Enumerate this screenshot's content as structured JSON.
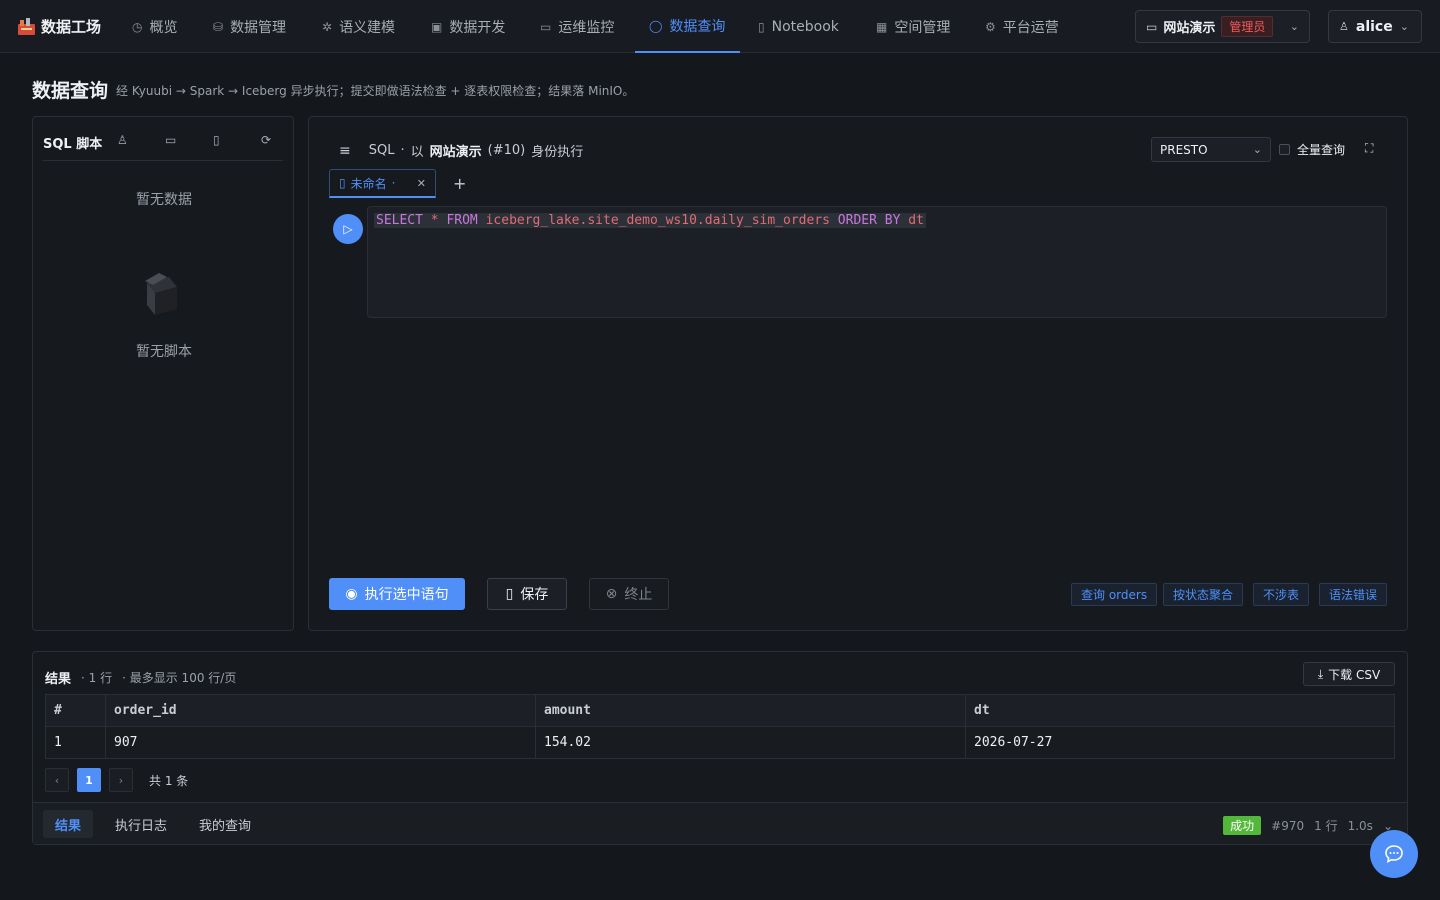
{
  "app": {
    "brand": "数据工场"
  },
  "nav": [
    {
      "icon": "dashboard-icon",
      "glyph": "◷",
      "label": "概览"
    },
    {
      "icon": "database-icon",
      "glyph": "⛁",
      "label": "数据管理"
    },
    {
      "icon": "sparkle-icon",
      "glyph": "✲",
      "label": "语义建模"
    },
    {
      "icon": "code-box-icon",
      "glyph": "▣",
      "label": "数据开发"
    },
    {
      "icon": "monitor-icon",
      "glyph": "▭",
      "label": "运维监控"
    },
    {
      "icon": "search-icon",
      "glyph": "◯",
      "label": "数据查询",
      "active": true
    },
    {
      "icon": "notebook-icon",
      "glyph": "▯",
      "label": "Notebook"
    },
    {
      "icon": "building-icon",
      "glyph": "▦",
      "label": "空间管理"
    },
    {
      "icon": "gear-icon",
      "glyph": "⚙",
      "label": "平台运营"
    }
  ],
  "workspace": {
    "name": "网站演示",
    "role": "管理员"
  },
  "user": {
    "name": "alice"
  },
  "page": {
    "title": "数据查询",
    "description": "经 Kyuubi → Spark → Iceberg 异步执行；提交即做语法检查 + 逐表权限检查；结果落 MinIO。"
  },
  "scripts_panel": {
    "title": "SQL 脚本",
    "no_data": "暂无数据",
    "empty": "暂无脚本"
  },
  "editor": {
    "mode_label": "SQL",
    "exec_prefix": "以",
    "workspace": "网站演示",
    "workspace_id": "(#10)",
    "exec_suffix": "身份执行",
    "engine": "PRESTO",
    "full_query_label": "全量查询",
    "tab_name": "未命名",
    "sql": {
      "select": "SELECT",
      "star": "*",
      "from": "FROM",
      "table": "iceberg_lake.site_demo_ws10.daily_sim_orders",
      "order_by": "ORDER BY",
      "col": "dt"
    },
    "run_label": "执行选中语句",
    "save_label": "保存",
    "stop_label": "终止",
    "snippets": [
      "查询 orders",
      "按状态聚合",
      "不涉表",
      "语法错误"
    ]
  },
  "results": {
    "title": "结果",
    "row_count": "· 1 行",
    "page_size_note": "· 最多显示 100 行/页",
    "download_label": "下载 CSV",
    "columns": [
      "#",
      "order_id",
      "amount",
      "dt"
    ],
    "rows": [
      [
        "1",
        "907",
        "154.02",
        "2026-07-27"
      ]
    ],
    "current_page": "1",
    "total": "共 1 条"
  },
  "bottom_tabs": [
    "结果",
    "执行日志",
    "我的查询"
  ],
  "status": {
    "label": "成功",
    "job_id": "#970",
    "rows": "1 行",
    "duration": "1.0s"
  },
  "colors": {
    "accent": "#4f8ff7",
    "success": "#52b83a",
    "danger": "#f15a5a"
  }
}
